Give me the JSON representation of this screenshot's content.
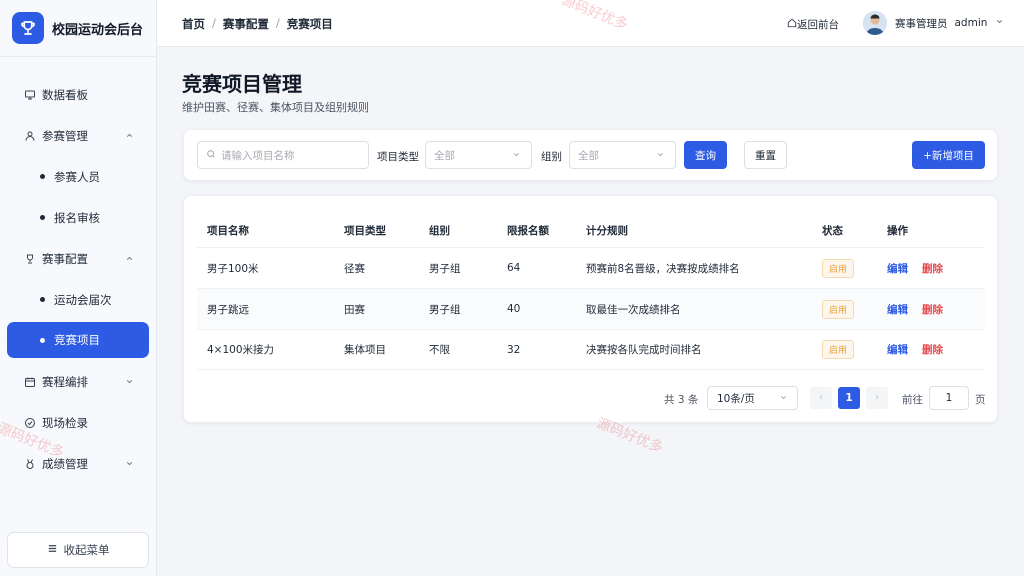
{
  "app": {
    "title": "校园运动会后台"
  },
  "sidebar": {
    "items": [
      {
        "label": "数据看板",
        "icon": "monitor-icon"
      },
      {
        "label": "参赛管理",
        "icon": "user-icon",
        "expanded": true
      },
      {
        "label": "参赛人员",
        "sub": true
      },
      {
        "label": "报名审核",
        "sub": true
      },
      {
        "label": "赛事配置",
        "icon": "trophy-icon",
        "expanded": true
      },
      {
        "label": "运动会届次",
        "sub": true
      },
      {
        "label": "竞赛项目",
        "sub": true,
        "active": true
      },
      {
        "label": "赛程编排",
        "icon": "calendar-icon",
        "expanded": false
      },
      {
        "label": "现场检录",
        "icon": "check-circle-icon"
      },
      {
        "label": "成绩管理",
        "icon": "medal-icon",
        "expanded": false
      }
    ],
    "collapse_label": "收起菜单"
  },
  "header": {
    "breadcrumb": [
      "首页",
      "赛事配置",
      "竞赛项目"
    ],
    "back_label": "返回前台",
    "role": "赛事管理员",
    "username": "admin"
  },
  "page": {
    "title": "竞赛项目管理",
    "description": "维护田赛、径赛、集体项目及组别规则"
  },
  "filters": {
    "search_placeholder": "请输入项目名称",
    "type_label": "项目类型",
    "type_value": "全部",
    "group_label": "组别",
    "group_value": "全部",
    "query_label": "查询",
    "reset_label": "重置",
    "add_label": "+新增项目"
  },
  "table": {
    "columns": [
      "项目名称",
      "项目类型",
      "组别",
      "限报名额",
      "计分规则",
      "状态",
      "操作"
    ],
    "rows": [
      {
        "name": "男子100米",
        "type": "径赛",
        "group": "男子组",
        "quota": "64",
        "rule": "预赛前8名晋级，决赛按成绩排名",
        "status": "启用"
      },
      {
        "name": "男子跳远",
        "type": "田赛",
        "group": "男子组",
        "quota": "40",
        "rule": "取最佳一次成绩排名",
        "status": "启用"
      },
      {
        "name": "4×100米接力",
        "type": "集体项目",
        "group": "不限",
        "quota": "32",
        "rule": "决赛按各队完成时间排名",
        "status": "启用"
      }
    ],
    "edit_label": "编辑",
    "delete_label": "删除"
  },
  "pagination": {
    "total": "共 3 条",
    "page_size": "10条/页",
    "current": "1",
    "goto_label": "前往",
    "goto_value": "1",
    "page_unit": "页"
  },
  "watermark": "源码好优多",
  "colors": {
    "primary": "#2d5be3",
    "danger": "#e5484d",
    "warning": "#e6a23c"
  }
}
